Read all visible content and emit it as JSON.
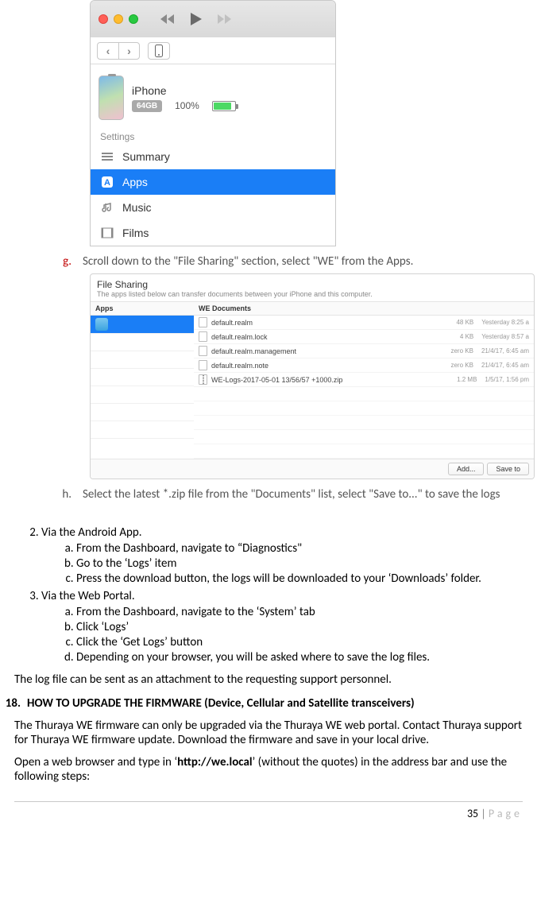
{
  "itunes": {
    "device_name": "iPhone",
    "capacity": "64GB",
    "battery_pct": "100%",
    "settings_label": "Settings",
    "items": {
      "summary": "Summary",
      "apps": "Apps",
      "music": "Music",
      "films": "Films"
    }
  },
  "step_g": {
    "marker": "g.",
    "text": "Scroll down to the \"File Sharing\" section, select \"WE\" from the Apps."
  },
  "fileshare": {
    "title": "File Sharing",
    "subtitle": "The apps listed below can transfer documents between your iPhone and this computer.",
    "apps_header": "Apps",
    "docs_header": "WE Documents",
    "docs": [
      {
        "name": "default.realm",
        "size": "48 KB",
        "date": "Yesterday 8:25 a"
      },
      {
        "name": "default.realm.lock",
        "size": "4 KB",
        "date": "Yesterday 8:57 a"
      },
      {
        "name": "default.realm.management",
        "size": "zero KB",
        "date": "21/4/17, 6:45 am"
      },
      {
        "name": "default.realm.note",
        "size": "zero KB",
        "date": "21/4/17, 6:45 am"
      },
      {
        "name": "WE-Logs-2017-05-01 13/56/57 +1000.zip",
        "size": "1.2 MB",
        "date": "1/5/17, 1:56 pm"
      }
    ],
    "add_btn": "Add...",
    "save_btn": "Save to"
  },
  "step_h": {
    "marker": "h.",
    "text": "Select the latest *.zip file from the \"Documents\" list, select \"Save to...\" to save the logs"
  },
  "section2": {
    "num": "2.",
    "title": "Via the Android App.",
    "a": "From the Dashboard, navigate to “Diagnostics\"",
    "b": "Go to the ‘Logs’ item",
    "c": "Press the download button, the logs will be downloaded to your ‘Downloads’ folder."
  },
  "section3": {
    "num": "3.",
    "title": "Via the Web Portal.",
    "a": "From the Dashboard, navigate to the ‘System’ tab",
    "b": "Click ‘Logs’",
    "c": "Click the ‘Get Logs’ button",
    "d": "Depending on your browser, you will be asked where to save the log files."
  },
  "para_attach": "The log file can be sent as an attachment to the requesting support personnel.",
  "heading18": {
    "num": "18.",
    "text": "HOW TO UPGRADE THE FIRMWARE (Device, Cellular and Satellite transceivers)"
  },
  "fw_para1": "The Thuraya WE firmware can only be upgraded via the Thuraya WE web portal. Contact Thuraya support for Thuraya WE firmware update.  Download the firmware and save in your local drive.",
  "fw_para2_a": "Open a web browser and type in ‘",
  "fw_para2_b": "http://we.local",
  "fw_para2_c": "’ (without the quotes) in the address bar and use the following steps:",
  "footer": {
    "page": "35",
    "sep": " | ",
    "label": "Page"
  }
}
